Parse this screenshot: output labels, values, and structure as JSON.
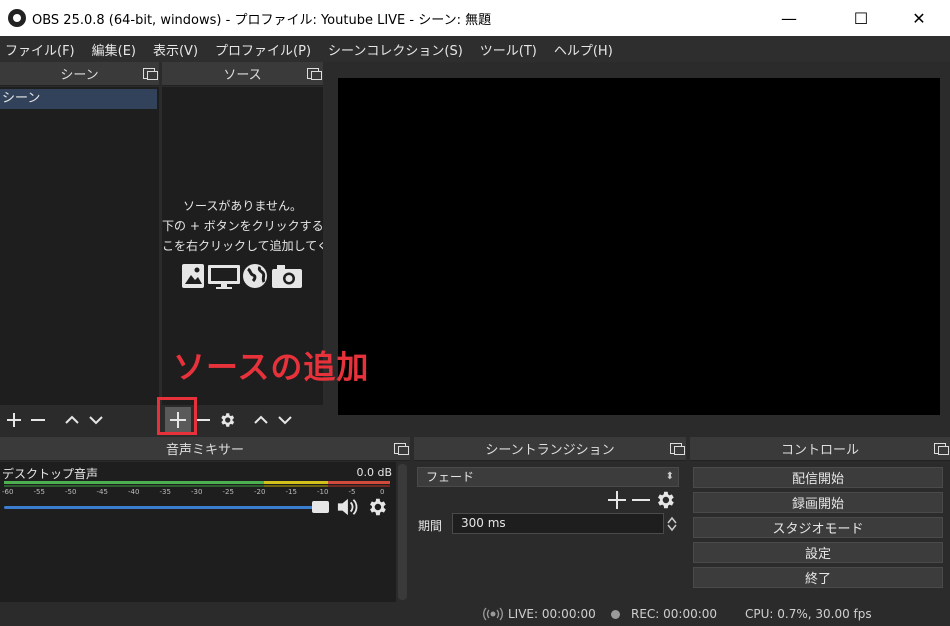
{
  "window": {
    "title": "OBS 25.0.8 (64-bit, windows) - プロファイル: Youtube LIVE - シーン: 無題",
    "minimize": "—",
    "maximize": "☐",
    "close": "✕"
  },
  "menu": [
    "ファイル(F)",
    "編集(E)",
    "表示(V)",
    "プロファイル(P)",
    "シーンコレクション(S)",
    "ツール(T)",
    "ヘルプ(H)"
  ],
  "scenes": {
    "title": "シーン",
    "items": [
      "シーン"
    ],
    "toolbar": [
      "+",
      "−",
      "∧",
      "∨"
    ]
  },
  "sources": {
    "title": "ソース",
    "empty_lines": [
      "ソースがありません。",
      "下の + ボタンをクリックするか、",
      "またはここを右クリックして追加してください。"
    ],
    "icons": [
      "image-icon",
      "monitor-icon",
      "globe-icon",
      "camera-icon"
    ],
    "toolbar": [
      "+",
      "−",
      "⚙",
      "∧",
      "∨"
    ]
  },
  "annotation": {
    "label": "ソースの追加",
    "color": "#e8323b"
  },
  "mixer": {
    "title": "音声ミキサー",
    "channel_name": "デスクトップ音声",
    "level": "0.0 dB",
    "ticks": [
      "-60",
      "-55",
      "-50",
      "-45",
      "-40",
      "-35",
      "-30",
      "-25",
      "-20",
      "-15",
      "-10",
      "-5",
      "0"
    ],
    "volume_fraction": 1.0
  },
  "transitions": {
    "title": "シーントランジション",
    "selected": "フェード",
    "duration_label": "期間",
    "duration_value": "300 ms"
  },
  "controls": {
    "title": "コントロール",
    "buttons": [
      "配信開始",
      "録画開始",
      "スタジオモード",
      "設定",
      "終了"
    ]
  },
  "status": {
    "live": "LIVE: 00:00:00",
    "rec": "REC: 00:00:00",
    "cpu": "CPU: 0.7%, 30.00 fps"
  },
  "colors": {
    "selected_scene": "#32425b",
    "volume_slider": "#3b7ecf",
    "meter_green": "#4caf50",
    "meter_yellow": "#d4c21c",
    "meter_red": "#d24a3b"
  }
}
